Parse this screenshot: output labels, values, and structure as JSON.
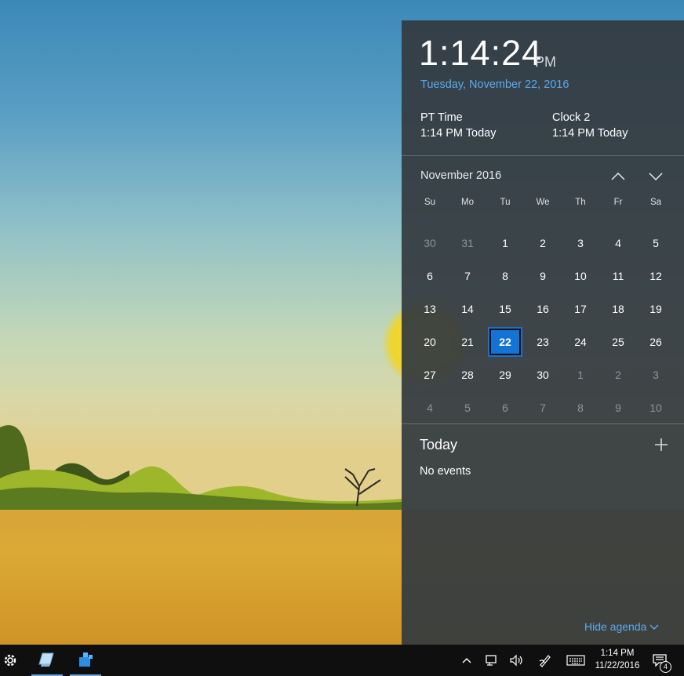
{
  "clock": {
    "time": "1:14:24",
    "ampm": "PM",
    "date": "Tuesday, November 22, 2016",
    "extra_clocks": [
      {
        "name": "PT Time",
        "value": "1:14 PM Today"
      },
      {
        "name": "Clock 2",
        "value": "1:14 PM Today"
      }
    ]
  },
  "calendar": {
    "month_title": "November 2016",
    "days_of_week": [
      "Su",
      "Mo",
      "Tu",
      "We",
      "Th",
      "Fr",
      "Sa"
    ],
    "weeks": [
      [
        "30",
        "31",
        "1",
        "2",
        "3",
        "4",
        "5"
      ],
      [
        "6",
        "7",
        "8",
        "9",
        "10",
        "11",
        "12"
      ],
      [
        "13",
        "14",
        "15",
        "16",
        "17",
        "18",
        "19"
      ],
      [
        "20",
        "21",
        "22",
        "23",
        "24",
        "25",
        "26"
      ],
      [
        "27",
        "28",
        "29",
        "30",
        "1",
        "2",
        "3"
      ],
      [
        "4",
        "5",
        "6",
        "7",
        "8",
        "9",
        "10"
      ]
    ],
    "selected_day": "22"
  },
  "agenda": {
    "title": "Today",
    "empty_text": "No events",
    "hide_label": "Hide agenda"
  },
  "taskbar": {
    "time": "1:14 PM",
    "date": "11/22/2016",
    "notification_count": "4"
  },
  "colors": {
    "accent": "#1474d4",
    "link": "#5aaaf0",
    "panel_bg": "#343a3f"
  }
}
